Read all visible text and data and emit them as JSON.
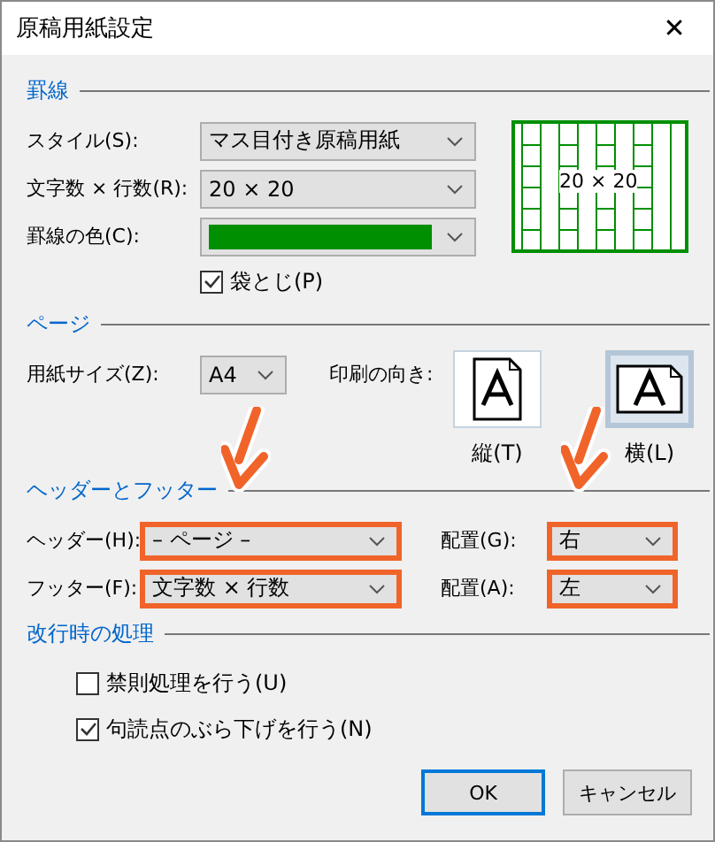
{
  "window": {
    "title": "原稿用紙設定",
    "close": "✕"
  },
  "ruled": {
    "heading": "罫線",
    "style": {
      "label": "スタイル(S):",
      "value": "マス目付き原稿用紙"
    },
    "size": {
      "label": "文字数 × 行数(R):",
      "value": "20 × 20"
    },
    "color": {
      "label": "罫線の色(C):",
      "color": "#008f00"
    },
    "fold": {
      "label": "袋とじ(P)",
      "checked": true
    },
    "preview": {
      "label": "20 × 20",
      "color": "#008f00"
    }
  },
  "page": {
    "heading": "ページ",
    "paper": {
      "label": "用紙サイズ(Z):",
      "value": "A4"
    },
    "orientation_label": "印刷の向き:",
    "orientations": [
      {
        "label": "縦(T)",
        "kind": "portrait",
        "selected": false
      },
      {
        "label": "横(L)",
        "kind": "landscape",
        "selected": true
      }
    ]
  },
  "header_footer": {
    "heading": "ヘッダーとフッター",
    "rows": [
      {
        "label": "ヘッダー(H):",
        "value": "– ページ –",
        "highlighted": true,
        "arrow": true,
        "align_label": "配置(G):",
        "align": "右",
        "align_highlighted": true,
        "align_arrow": true
      },
      {
        "label": "フッター(F):",
        "value": "文字数 × 行数",
        "highlighted": true,
        "arrow": false,
        "align_label": "配置(A):",
        "align": "左",
        "align_highlighted": true,
        "align_arrow": false
      }
    ]
  },
  "line_break": {
    "heading": "改行時の処理",
    "options": [
      {
        "label": "禁則処理を行う(U)",
        "checked": false
      },
      {
        "label": "句読点のぶら下げを行う(N)",
        "checked": true
      }
    ]
  },
  "buttons": [
    {
      "label": "OK",
      "default": true
    },
    {
      "label": "キャンセル",
      "default": false
    }
  ]
}
